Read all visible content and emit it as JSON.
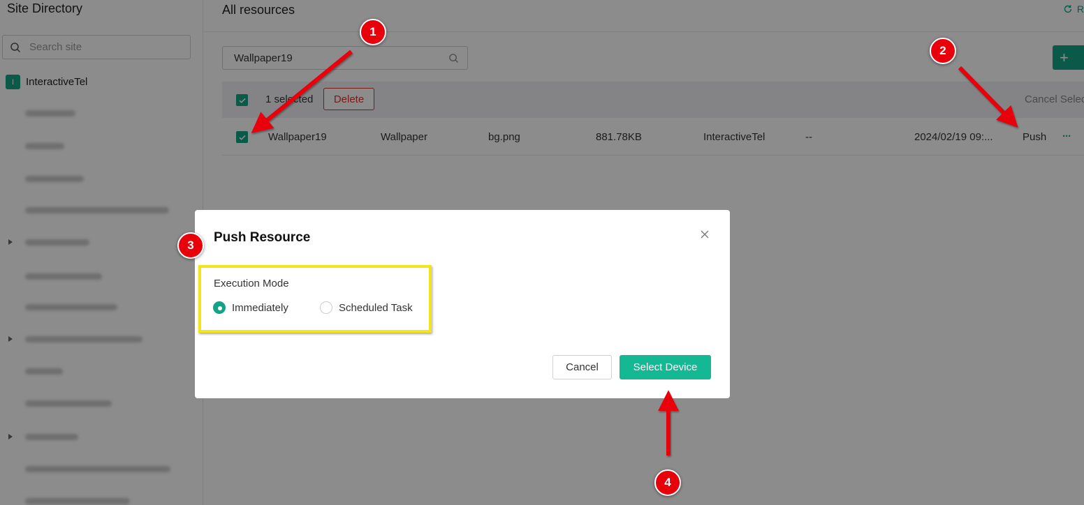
{
  "sidebar": {
    "title": "Site Directory",
    "search_placeholder": "Search site",
    "root": {
      "badge": "I",
      "label": "InteractiveTel"
    }
  },
  "main": {
    "title": "All resources",
    "refresh_label": "R",
    "search_value": "Wallpaper19",
    "add_label": "+"
  },
  "bulk": {
    "selected_text": "1 selected",
    "delete_label": "Delete",
    "cancel_select_label": "Cancel Selec"
  },
  "row": {
    "name": "Wallpaper19",
    "type": "Wallpaper",
    "file": "bg.png",
    "size": "881.78KB",
    "site": "InteractiveTel",
    "note": "--",
    "date": "2024/02/19 09:...",
    "push_label": "Push",
    "more_label": "···"
  },
  "modal": {
    "title": "Push Resource",
    "mode_label": "Execution Mode",
    "options": [
      "Immediately",
      "Scheduled Task"
    ],
    "selected_option": "Immediately",
    "cancel_label": "Cancel",
    "confirm_label": "Select Device"
  },
  "markers": [
    "1",
    "2",
    "3",
    "4"
  ],
  "colors": {
    "accent": "#13a386",
    "danger": "#d9342b",
    "marker": "#e8000b",
    "highlight": "#f2e51b"
  }
}
